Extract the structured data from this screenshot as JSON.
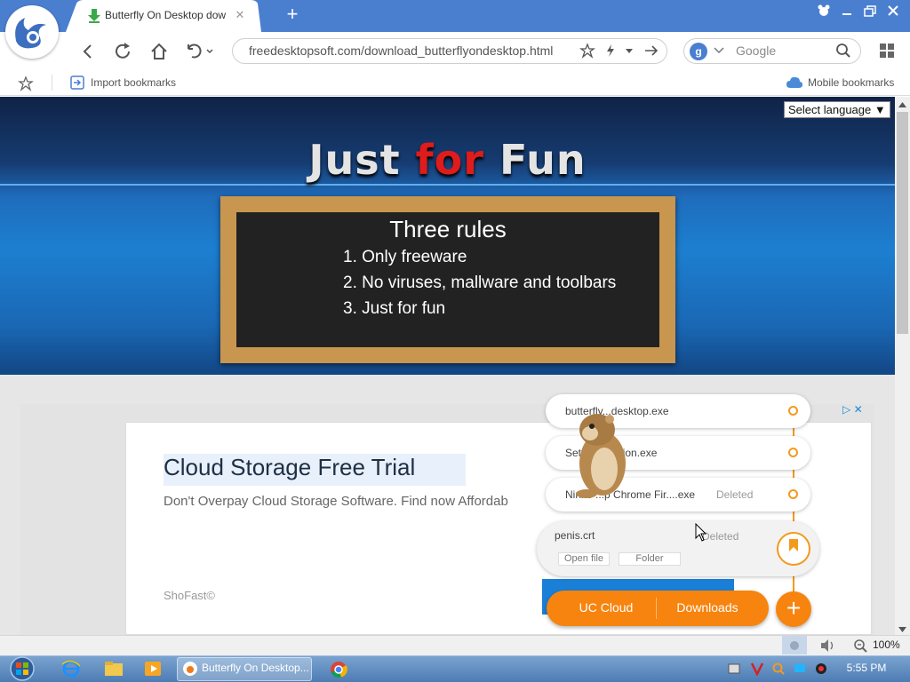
{
  "browser": {
    "tab_title": "Butterfly On Desktop dow",
    "tab_close": "✕",
    "new_tab": "+",
    "url": "freedesktopsoft.com/download_butterflyondesktop.html",
    "search_engine": "g",
    "search_placeholder": "Google",
    "bookmarks": {
      "import_label": "Import bookmarks",
      "mobile_label": "Mobile bookmarks"
    }
  },
  "page": {
    "hero_title": {
      "part1": "Just ",
      "part2": "for",
      "part3": " Fun"
    },
    "board": {
      "title": "Three rules",
      "rules": [
        "1. Only freeware",
        "2. No viruses, mallware and toolbars",
        "3. Just for fun"
      ]
    },
    "language_select": "Select language ▼",
    "ad": {
      "title": "Cloud Storage Free Trial",
      "description": "Don't Overpay Cloud Storage Software. Find now Affordab",
      "brand": "ShoFast©",
      "choice": "▷ ✕"
    }
  },
  "downloads": {
    "items": [
      {
        "name": "butterfly...desktop.exe",
        "status": ""
      },
      {
        "name": "Set...ompanion.exe",
        "status": ""
      },
      {
        "name": "Ninite ...p Chrome Fir....exe",
        "status": "Deleted"
      },
      {
        "name": "penis.crt",
        "status": "Deleted"
      }
    ],
    "open_file": "Open file",
    "folder": "Folder",
    "uc_cloud": "UC Cloud",
    "downloads_label": "Downloads",
    "plus": "+"
  },
  "status_bar": {
    "zoom": "100%"
  },
  "taskbar": {
    "active_window": "Butterfly On Desktop...",
    "clock": "5:55 PM"
  },
  "colors": {
    "accent": "#4a7fd0",
    "orange": "#f7840f",
    "hero_red": "#e01b1b"
  }
}
